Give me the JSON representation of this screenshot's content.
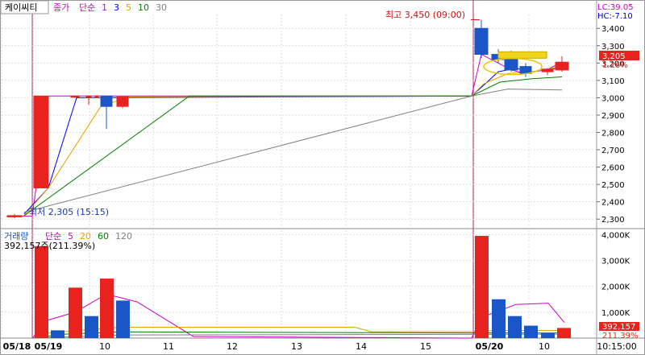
{
  "header": {
    "stock_name": "케이씨티",
    "price_label": "종가",
    "ma_label": "단순",
    "ma_periods": [
      {
        "label": "1",
        "color": "#cc00cc"
      },
      {
        "label": "3",
        "color": "#0000ff"
      },
      {
        "label": "5",
        "color": "#e8a000"
      },
      {
        "label": "10",
        "color": "#008000"
      },
      {
        "label": "30",
        "color": "#808080"
      }
    ]
  },
  "corner": {
    "lc": "LC:39.05",
    "hc": "HC:-7.10"
  },
  "price_badge": "3,205",
  "pct_badge": "1.26%",
  "vol_badge": "392,157",
  "vol_pct_badge": "211.39%",
  "volume_header": {
    "title": "거래량",
    "ma_label": "단순",
    "ma_periods": [
      {
        "label": "5",
        "color": "#cc00cc"
      },
      {
        "label": "20",
        "color": "#e8a000"
      },
      {
        "label": "60",
        "color": "#008000"
      },
      {
        "label": "120",
        "color": "#808080"
      }
    ],
    "current": "392,157주(211.39%)"
  },
  "annotations": {
    "high": "최고 3,450 (09:00)",
    "low": "최저 2,305 (15:15)"
  },
  "colors": {
    "up": "#e8221c",
    "down": "#1a56c8",
    "ma1": "#cc00cc",
    "ma3": "#0000ff",
    "ma5": "#e8a000",
    "ma10": "#008000",
    "ma30": "#808080"
  },
  "chart_data": [
    {
      "type": "candlestick",
      "title": "케이씨티",
      "y_ticks": [
        "3,400",
        "3,300",
        "3,200",
        "3,100",
        "3,000",
        "2,900",
        "2,800",
        "2,700",
        "2,600",
        "2,500",
        "2,400",
        "2,300"
      ],
      "ylim": [
        2250,
        3480
      ],
      "candles": [
        {
          "o": 2320,
          "h": 2330,
          "l": 2305,
          "c": 2318,
          "dir": "up"
        },
        {
          "o": 2480,
          "h": 3010,
          "l": 2480,
          "c": 3010,
          "dir": "up"
        },
        {
          "o": 3010,
          "h": 3010,
          "l": 3010,
          "c": 3010,
          "dir": "up"
        },
        {
          "o": 3010,
          "h": 3010,
          "l": 2960,
          "c": 3010,
          "dir": "up"
        },
        {
          "o": 3010,
          "h": 3010,
          "l": 3010,
          "c": 3010,
          "dir": "up"
        },
        {
          "o": 3010,
          "h": 3010,
          "l": 2820,
          "c": 2950,
          "dir": "down"
        },
        {
          "o": 2950,
          "h": 3010,
          "l": 2940,
          "c": 3005,
          "dir": "up"
        },
        {
          "o": 3400,
          "h": 3450,
          "l": 3230,
          "c": 3250,
          "dir": "down"
        },
        {
          "o": 3250,
          "h": 3280,
          "l": 3200,
          "c": 3220,
          "dir": "down"
        },
        {
          "o": 3260,
          "h": 3270,
          "l": 3150,
          "c": 3160,
          "dir": "down"
        },
        {
          "o": 3180,
          "h": 3200,
          "l": 3120,
          "c": 3140,
          "dir": "down"
        },
        {
          "o": 3150,
          "h": 3170,
          "l": 3130,
          "c": 3165,
          "dir": "up"
        },
        {
          "o": 3160,
          "h": 3240,
          "l": 3150,
          "c": 3205,
          "dir": "up"
        }
      ]
    },
    {
      "type": "bar",
      "title": "거래량",
      "y_ticks": [
        "4,000K",
        "3,000K",
        "2,000K",
        "1,000K"
      ],
      "ylim": [
        0,
        4200000
      ],
      "values": [
        {
          "v": 3550000,
          "dir": "up"
        },
        {
          "v": 300000,
          "dir": "down"
        },
        {
          "v": 1950000,
          "dir": "up"
        },
        {
          "v": 850000,
          "dir": "down"
        },
        {
          "v": 2300000,
          "dir": "up"
        },
        {
          "v": 1450000,
          "dir": "down"
        },
        {
          "v": 3950000,
          "dir": "up"
        },
        {
          "v": 1500000,
          "dir": "down"
        },
        {
          "v": 850000,
          "dir": "down"
        },
        {
          "v": 480000,
          "dir": "down"
        },
        {
          "v": 200000,
          "dir": "down"
        },
        {
          "v": 392157,
          "dir": "up"
        }
      ]
    }
  ],
  "x_ticks": [
    "05/18",
    "05/19",
    "10",
    "11",
    "12",
    "13",
    "14",
    "15",
    "05/20",
    "10",
    "10:15:00"
  ]
}
